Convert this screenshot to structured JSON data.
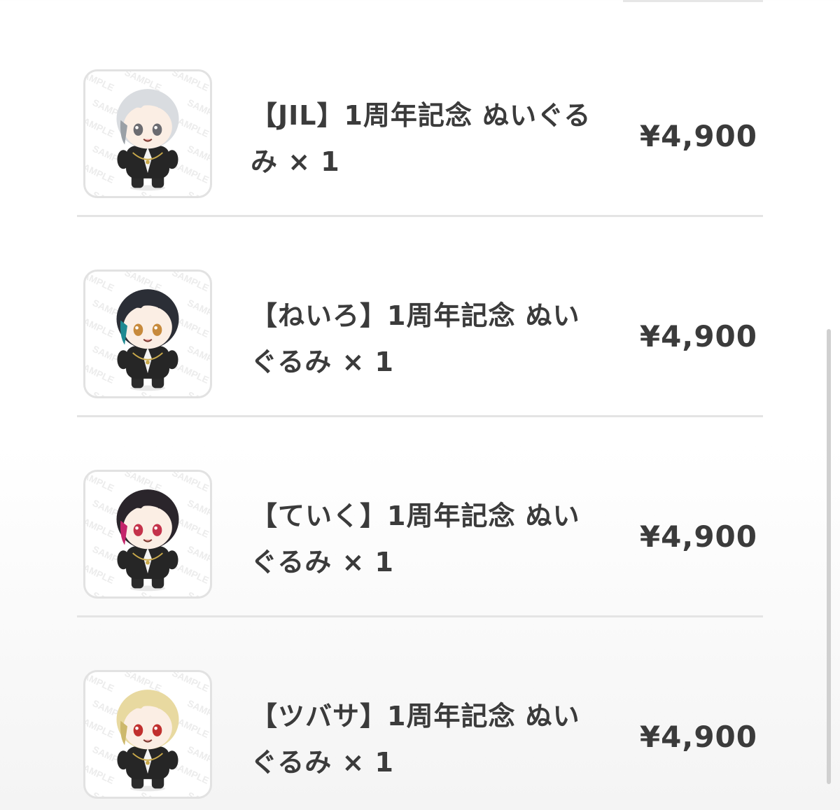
{
  "order": {
    "items": [
      {
        "name": "【JIL】1周年記念 ぬいぐるみ × 1",
        "price": "¥4,900",
        "hair_color": "#d9dce0",
        "accent_color": "#9aa0a6",
        "eye_color": "#6b6b70",
        "thumb_watermark": "SAMPLE"
      },
      {
        "name": "【ねいろ】1周年記念 ぬいぐるみ × 1",
        "price": "¥4,900",
        "hair_color": "#2b2e36",
        "accent_color": "#1f8a92",
        "eye_color": "#c78a3c",
        "thumb_watermark": "SAMPLE"
      },
      {
        "name": "【ていく】1周年記念 ぬいぐるみ × 1",
        "price": "¥4,900",
        "hair_color": "#2a252b",
        "accent_color": "#c4246a",
        "eye_color": "#c4324a",
        "thumb_watermark": "SAMPLE"
      },
      {
        "name": "【ツバサ】1周年記念 ぬいぐるみ × 1",
        "price": "¥4,900",
        "hair_color": "#e8d9a0",
        "accent_color": "#cdb86c",
        "eye_color": "#c0302e",
        "thumb_watermark": "SAMPLE"
      }
    ]
  }
}
